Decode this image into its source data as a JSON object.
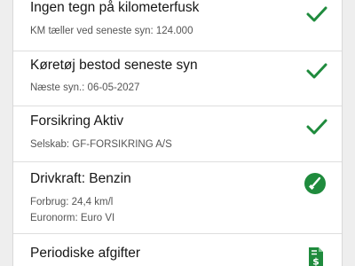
{
  "colors": {
    "accent_green": "#1f8b3d",
    "background": "#eeeeee",
    "card": "#ffffff"
  },
  "rows": [
    {
      "title": "Ingen tegn på kilometerfusk",
      "lines": [
        "KM tæller ved seneste syn: 124.000"
      ],
      "icon": "check-icon"
    },
    {
      "title": "Køretøj bestod seneste syn",
      "lines": [
        "Næste syn.: 06-05-2027"
      ],
      "icon": "check-icon"
    },
    {
      "title": "Forsikring Aktiv",
      "lines": [
        "Selskab: GF-FORSIKRING A/S"
      ],
      "icon": "check-icon"
    },
    {
      "title": "Drivkraft: Benzin",
      "lines": [
        "Forbrug: 24,4 km/l",
        "Euronorm: Euro VI"
      ],
      "icon": "fuel-pump-icon"
    },
    {
      "title": "Periodiske afgifter",
      "lines": [],
      "icon": "dollar-document-icon"
    }
  ]
}
